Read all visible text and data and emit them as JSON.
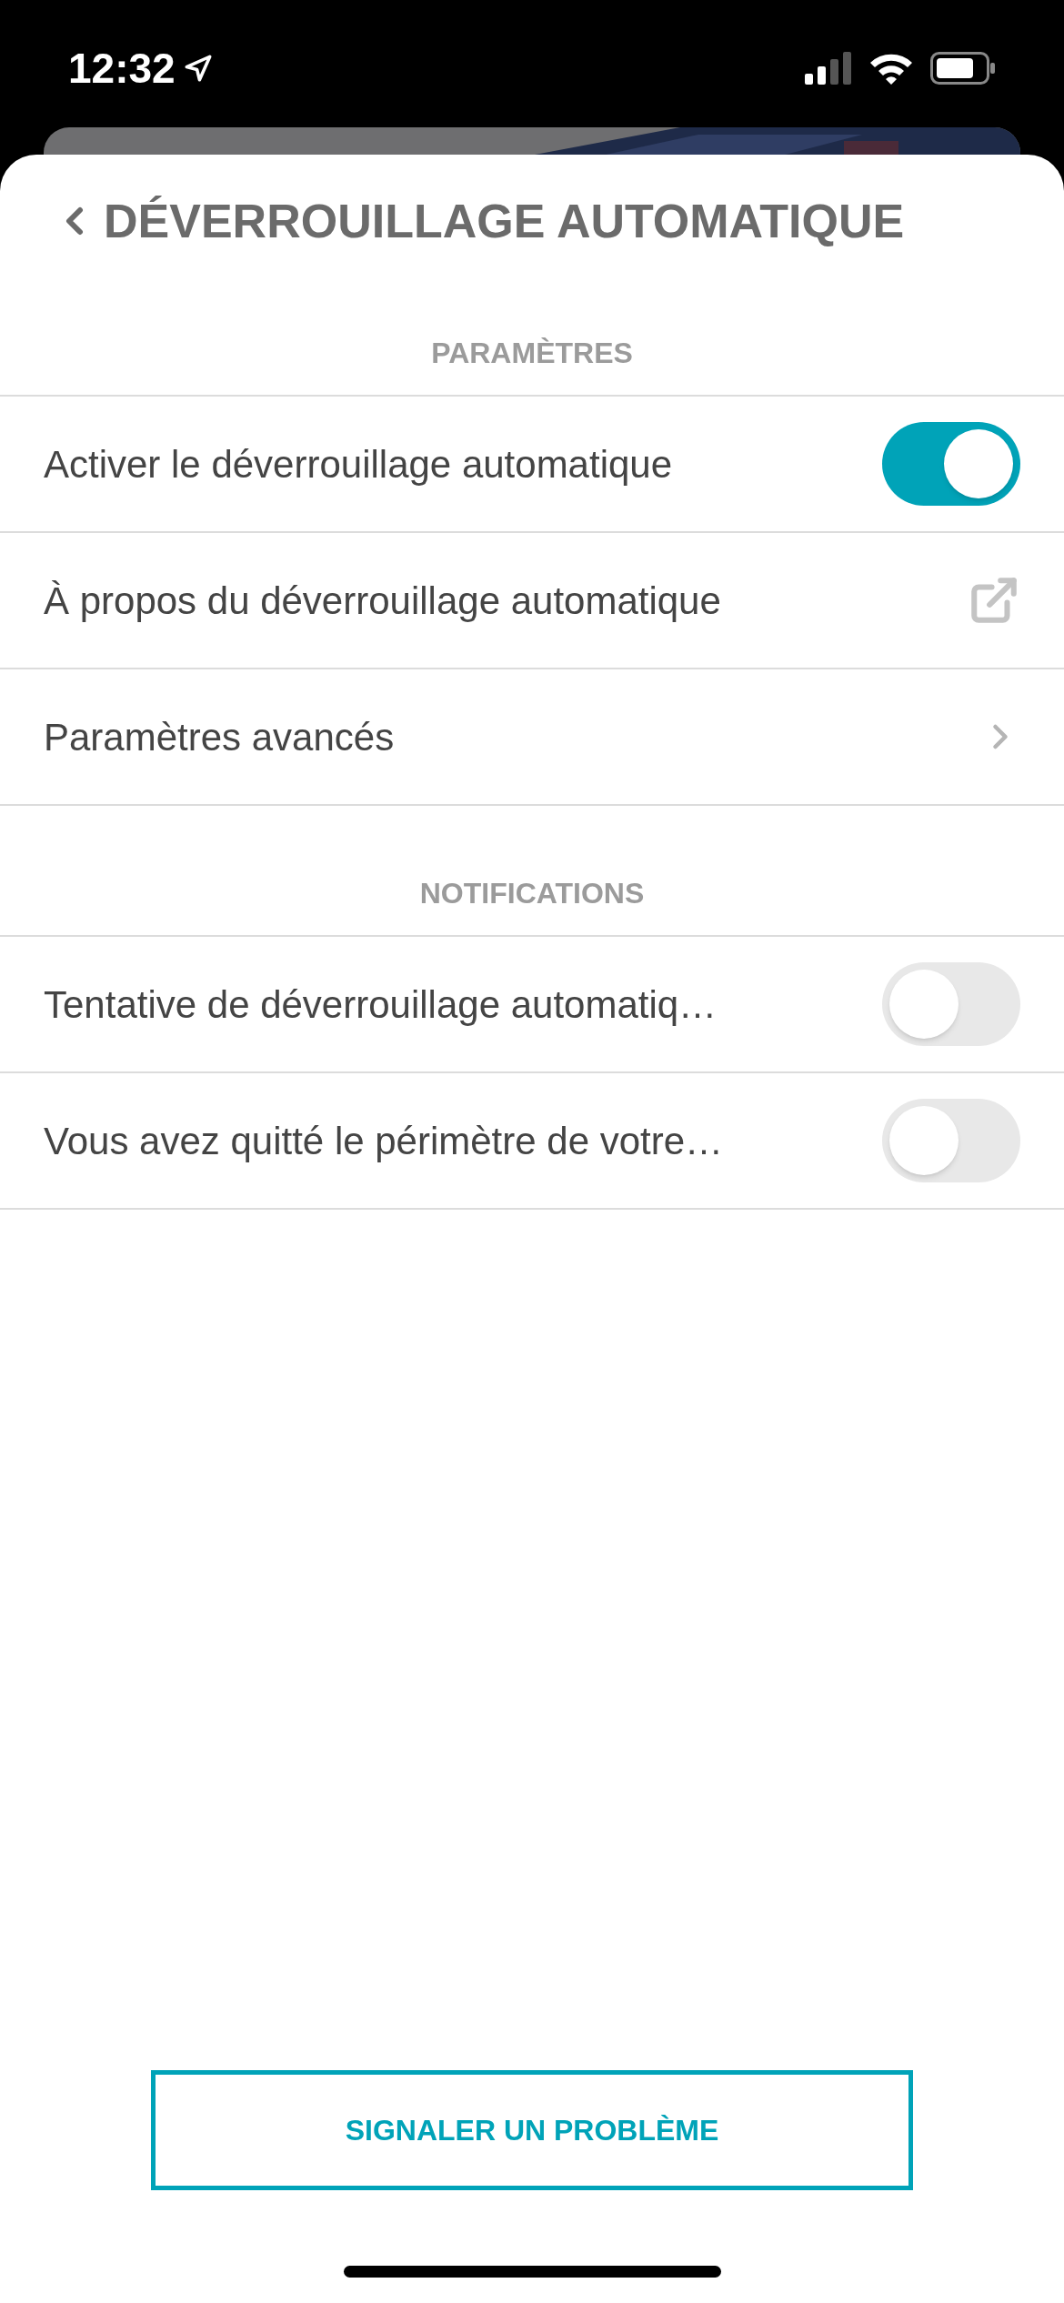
{
  "status_bar": {
    "time": "12:32"
  },
  "header": {
    "title": "DÉVERROUILLAGE AUTOMATIQUE"
  },
  "sections": [
    {
      "title": "PARAMÈTRES",
      "rows": [
        {
          "kind": "toggle",
          "label": "Activer le déverrouillage automatique",
          "on": true
        },
        {
          "kind": "external",
          "label": "À propos du déverrouillage automatique"
        },
        {
          "kind": "chevron",
          "label": "Paramètres avancés"
        }
      ]
    },
    {
      "title": "NOTIFICATIONS",
      "rows": [
        {
          "kind": "toggle",
          "label": "Tentative de déverrouillage automatiq…",
          "on": false
        },
        {
          "kind": "toggle",
          "label": "Vous avez quitté le périmètre de votre…",
          "on": false
        }
      ]
    }
  ],
  "report_button": {
    "label": "SIGNALER UN PROBLÈME"
  }
}
